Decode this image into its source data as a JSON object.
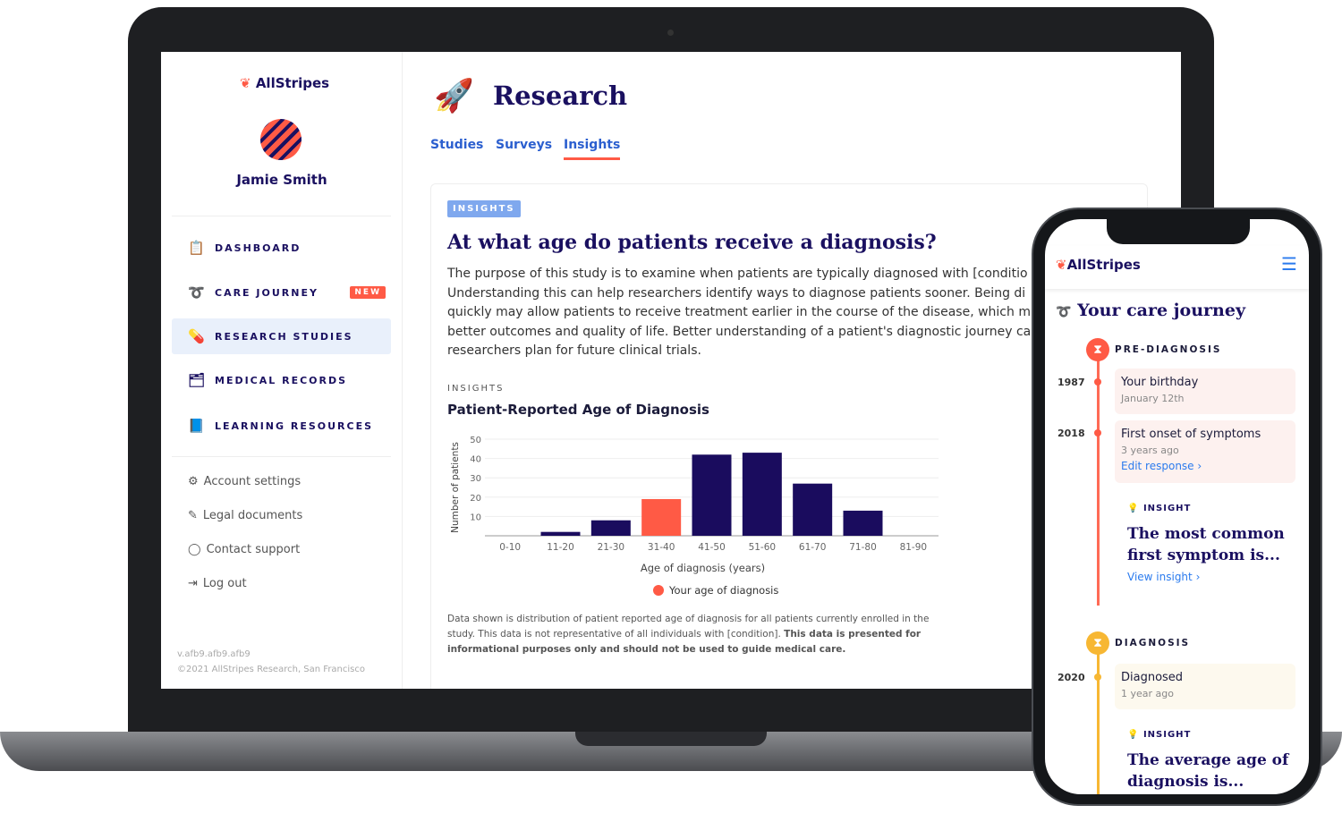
{
  "laptop": {
    "sidebar": {
      "logo": "AllStripes",
      "user_name": "Jamie Smith",
      "nav": [
        {
          "label": "DASHBOARD",
          "icon": "clipboard-icon"
        },
        {
          "label": "CARE JOURNEY",
          "icon": "route-icon",
          "badge": "NEW"
        },
        {
          "label": "RESEARCH STUDIES",
          "icon": "pills-icon",
          "active": true
        },
        {
          "label": "MEDICAL RECORDS",
          "icon": "records-icon"
        },
        {
          "label": "LEARNING RESOURCES",
          "icon": "book-icon"
        }
      ],
      "secondary": [
        {
          "label": "Account settings",
          "icon": "gear-icon"
        },
        {
          "label": "Legal documents",
          "icon": "document-icon"
        },
        {
          "label": "Contact support",
          "icon": "chat-icon"
        },
        {
          "label": "Log out",
          "icon": "logout-icon"
        }
      ],
      "version": "v.afb9.afb9.afb9",
      "copyright": "©2021 AllStripes Research, San Francisco"
    },
    "header": {
      "title": "Research",
      "tabs": [
        {
          "label": "Studies"
        },
        {
          "label": "Surveys"
        },
        {
          "label": "Insights",
          "active": true
        }
      ]
    },
    "card": {
      "badge": "INSIGHTS",
      "title": "At what age do patients receive a diagnosis?",
      "body_lines": [
        "The purpose of this study is to examine when patients are typically diagnosed with [conditio",
        "Understanding this can help researchers identify ways to diagnose patients sooner. Being di",
        "quickly may allow patients to receive treatment earlier in the course of the disease, which m",
        "better outcomes and quality of life. Better understanding of a patient's diagnostic journey ca",
        "researchers plan for future clinical trials."
      ],
      "section_label": "INSIGHTS",
      "chart_title": "Patient-Reported Age of Diagnosis",
      "footnote": "Data shown is distribution of patient reported age of diagnosis for all patients currently enrolled in the study. This data is not representative of all individuals with [condition].",
      "footnote_bold": "This data is presented for informational purposes only and should not be used to guide medical care."
    }
  },
  "chart_data": {
    "type": "bar",
    "xlabel": "Age of diagnosis (years)",
    "ylabel": "Number of patients",
    "ylim": [
      0,
      50
    ],
    "yticks": [
      10,
      20,
      30,
      40,
      50
    ],
    "grid": true,
    "categories": [
      "0-10",
      "11-20",
      "21-30",
      "31-40",
      "41-50",
      "51-60",
      "61-70",
      "71-80",
      "81-90"
    ],
    "values": [
      0,
      2,
      8,
      19,
      42,
      43,
      27,
      13,
      0
    ],
    "highlight_index": 3,
    "colors": {
      "bar": "#1a0c5e",
      "highlight": "#ff5a45"
    },
    "legend": "Your age of diagnosis",
    "legend_placement": "bottom"
  },
  "phone": {
    "logo": "AllStripes",
    "menu_icon": "hamburger-icon",
    "title": "Your care journey",
    "stages": [
      {
        "label": "PRE-DIAGNOSIS",
        "color": "#ff5a45"
      },
      {
        "label": "DIAGNOSIS",
        "color": "#f7b733"
      }
    ],
    "events": [
      {
        "year": "1987",
        "title": "Your birthday",
        "sub": "January 12th"
      },
      {
        "year": "2018",
        "title": "First onset of symptoms",
        "sub": "3 years ago",
        "link": "Edit response"
      },
      {
        "year": "2020",
        "title": "Diagnosed",
        "sub": "1 year ago"
      }
    ],
    "insights": [
      {
        "label": "INSIGHT",
        "title": "The most common first symptom is...",
        "link": "View insight"
      },
      {
        "label": "INSIGHT",
        "title": "The average age of diagnosis is..."
      }
    ]
  }
}
